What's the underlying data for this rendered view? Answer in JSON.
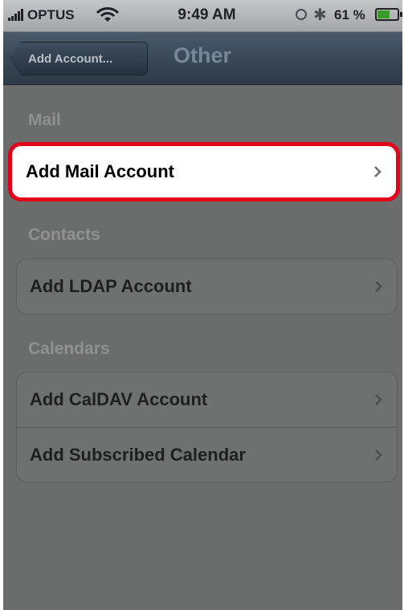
{
  "status_bar": {
    "carrier": "OPTUS",
    "time": "9:49 AM",
    "battery": "61 %",
    "battery_level": 0.61
  },
  "nav": {
    "back_label": "Add Account...",
    "title": "Other"
  },
  "sections": {
    "mail": {
      "header": "Mail",
      "items": [
        "Add Mail Account"
      ]
    },
    "contacts": {
      "header": "Contacts",
      "items": [
        "Add LDAP Account"
      ]
    },
    "calendars": {
      "header": "Calendars",
      "items": [
        "Add CalDAV Account",
        "Add Subscribed Calendar"
      ]
    }
  },
  "colors": {
    "highlight": "#e2001a"
  }
}
